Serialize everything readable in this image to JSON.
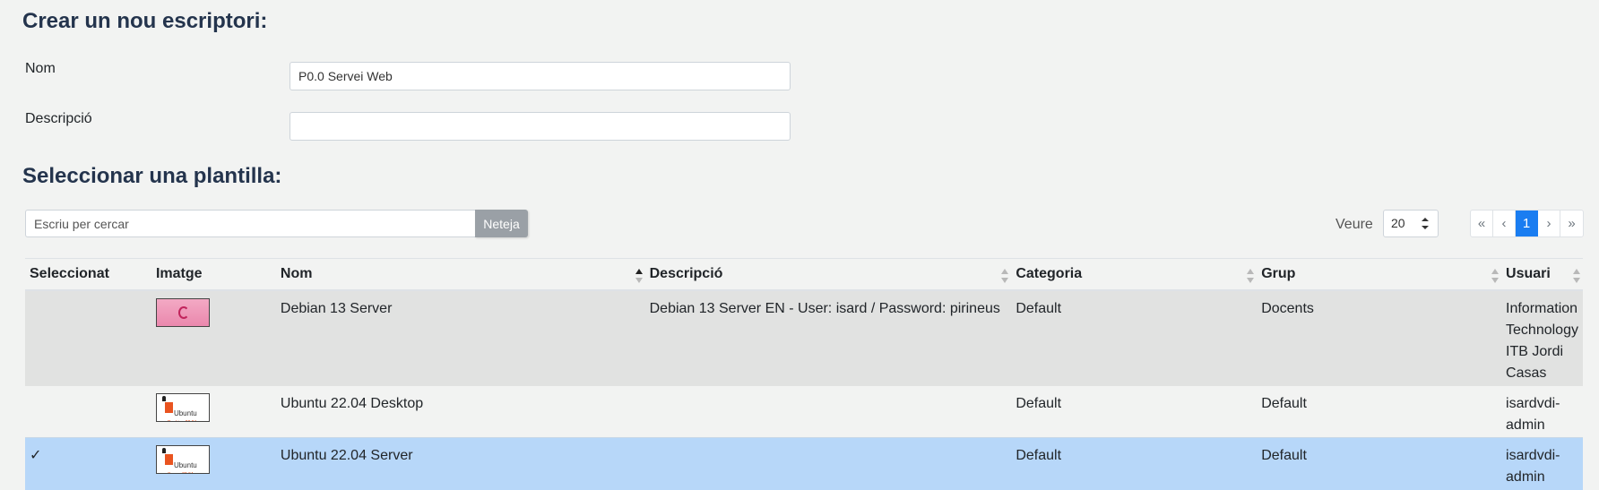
{
  "create_section": {
    "title": "Crear un nou escriptori:",
    "name_label": "Nom",
    "name_value": "P0.0 Servei Web",
    "description_label": "Descripció",
    "description_value": ""
  },
  "template_section": {
    "title": "Seleccionar una plantilla:",
    "search": {
      "placeholder": "Escriu per cercar",
      "clear_label": "Neteja"
    },
    "page_size": {
      "label": "Veure",
      "value": "20"
    },
    "pagination": {
      "first": "«",
      "prev": "‹",
      "current": "1",
      "next": "›",
      "last": "»"
    },
    "columns": {
      "selected": "Seleccionat",
      "image": "Imatge",
      "name": "Nom",
      "description": "Descripció",
      "category": "Categoria",
      "group": "Grup",
      "user": "Usuari"
    },
    "rows": [
      {
        "selected": "",
        "image_icon": "debian-thumbnail",
        "name": "Debian 13 Server",
        "description": "Debian 13 Server EN - User: isard / Password: pirineus",
        "category": "Default",
        "group": "Docents",
        "user": "Information Technology ITB Jordi Casas"
      },
      {
        "selected": "",
        "image_icon": "ubuntu-desktop-thumbnail",
        "image_caption": "Desktop 22.04",
        "name": "Ubuntu 22.04 Desktop",
        "description": "",
        "category": "Default",
        "group": "Default",
        "user": "isardvdi-admin"
      },
      {
        "selected": "✓",
        "image_icon": "ubuntu-server-thumbnail",
        "image_caption": "Server 22.04",
        "name": "Ubuntu 22.04 Server",
        "description": "",
        "category": "Default",
        "group": "Default",
        "user": "isardvdi-admin"
      }
    ],
    "thumbnail_word": "Ubuntu",
    "colors": {
      "selected_row": "#b7d7f9",
      "active_page": "#1a7df1",
      "title": "#24344d"
    }
  }
}
